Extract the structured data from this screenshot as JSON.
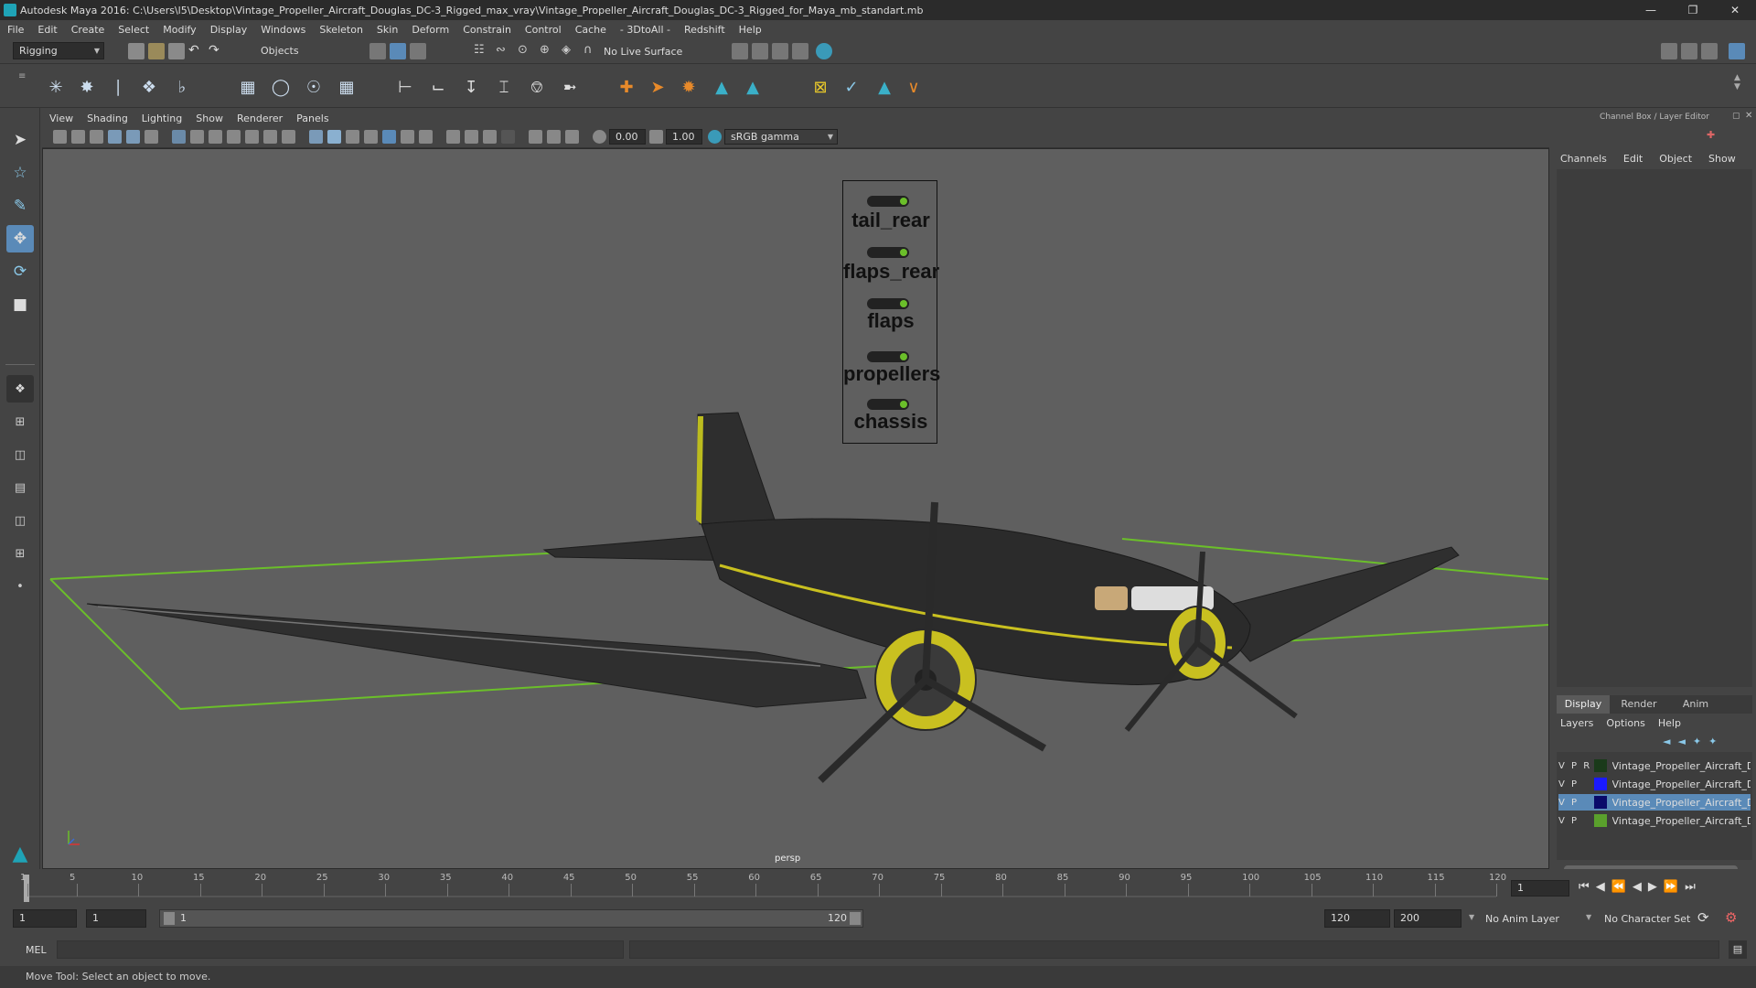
{
  "window": {
    "title": "Autodesk Maya 2016: C:\\Users\\l5\\Desktop\\Vintage_Propeller_Aircraft_Douglas_DC-3_Rigged_max_vray\\Vintage_Propeller_Aircraft_Douglas_DC-3_Rigged_for_Maya_mb_standart.mb",
    "controls": [
      "minimize-icon",
      "maximize-icon",
      "close-icon"
    ]
  },
  "menubar": [
    "File",
    "Edit",
    "Create",
    "Select",
    "Modify",
    "Display",
    "Windows",
    "Skeleton",
    "Skin",
    "Deform",
    "Constrain",
    "Control",
    "Cache",
    "- 3DtoAll -",
    "Redshift",
    "Help"
  ],
  "statusline": {
    "menuset": "Rigging",
    "selection_mode": "Objects",
    "live_surface": "No Live Surface"
  },
  "viewport": {
    "menu": [
      "View",
      "Shading",
      "Lighting",
      "Show",
      "Renderer",
      "Panels"
    ],
    "exposure": "0.00",
    "gamma": "1.00",
    "color_space": "sRGB gamma",
    "camera_label": "persp",
    "rig_controls": [
      "tail_rear",
      "flaps_rear",
      "flaps",
      "propellers",
      "chassis"
    ]
  },
  "channelbox": {
    "title": "Channel Box / Layer Editor",
    "menu": [
      "Channels",
      "Edit",
      "Object",
      "Show"
    ]
  },
  "layers": {
    "tabs": [
      "Display",
      "Render",
      "Anim"
    ],
    "active_tab": "Display",
    "menu": [
      "Layers",
      "Options",
      "Help"
    ],
    "rows": [
      {
        "flags": "V P R",
        "name": "Vintage_Propeller_Aircraft_D",
        "color": "#1a3a1a",
        "selected": false
      },
      {
        "flags": "V P",
        "name": "Vintage_Propeller_Aircraft_D",
        "color": "#1a1aff",
        "selected": false
      },
      {
        "flags": "V P",
        "name": "Vintage_Propeller_Aircraft_D",
        "color": "#0a0a6a",
        "selected": true
      },
      {
        "flags": "V P",
        "name": "Vintage_Propeller_Aircraft_D",
        "color": "#5aa02c",
        "selected": false
      }
    ]
  },
  "timeline": {
    "ticks": [
      "1",
      "5",
      "10",
      "15",
      "20",
      "25",
      "30",
      "35",
      "40",
      "45",
      "50",
      "55",
      "60",
      "65",
      "70",
      "75",
      "80",
      "85",
      "90",
      "95",
      "100",
      "105",
      "110",
      "115",
      "120"
    ],
    "current_frame": "1"
  },
  "range": {
    "start": "1",
    "playback_start": "1",
    "slider_start": "1",
    "slider_end": "120",
    "playback_end": "120",
    "end": "200",
    "anim_layer": "No Anim Layer",
    "character_set": "No Character Set"
  },
  "command": {
    "label": "MEL"
  },
  "help_line": "Move Tool: Select an object to move."
}
